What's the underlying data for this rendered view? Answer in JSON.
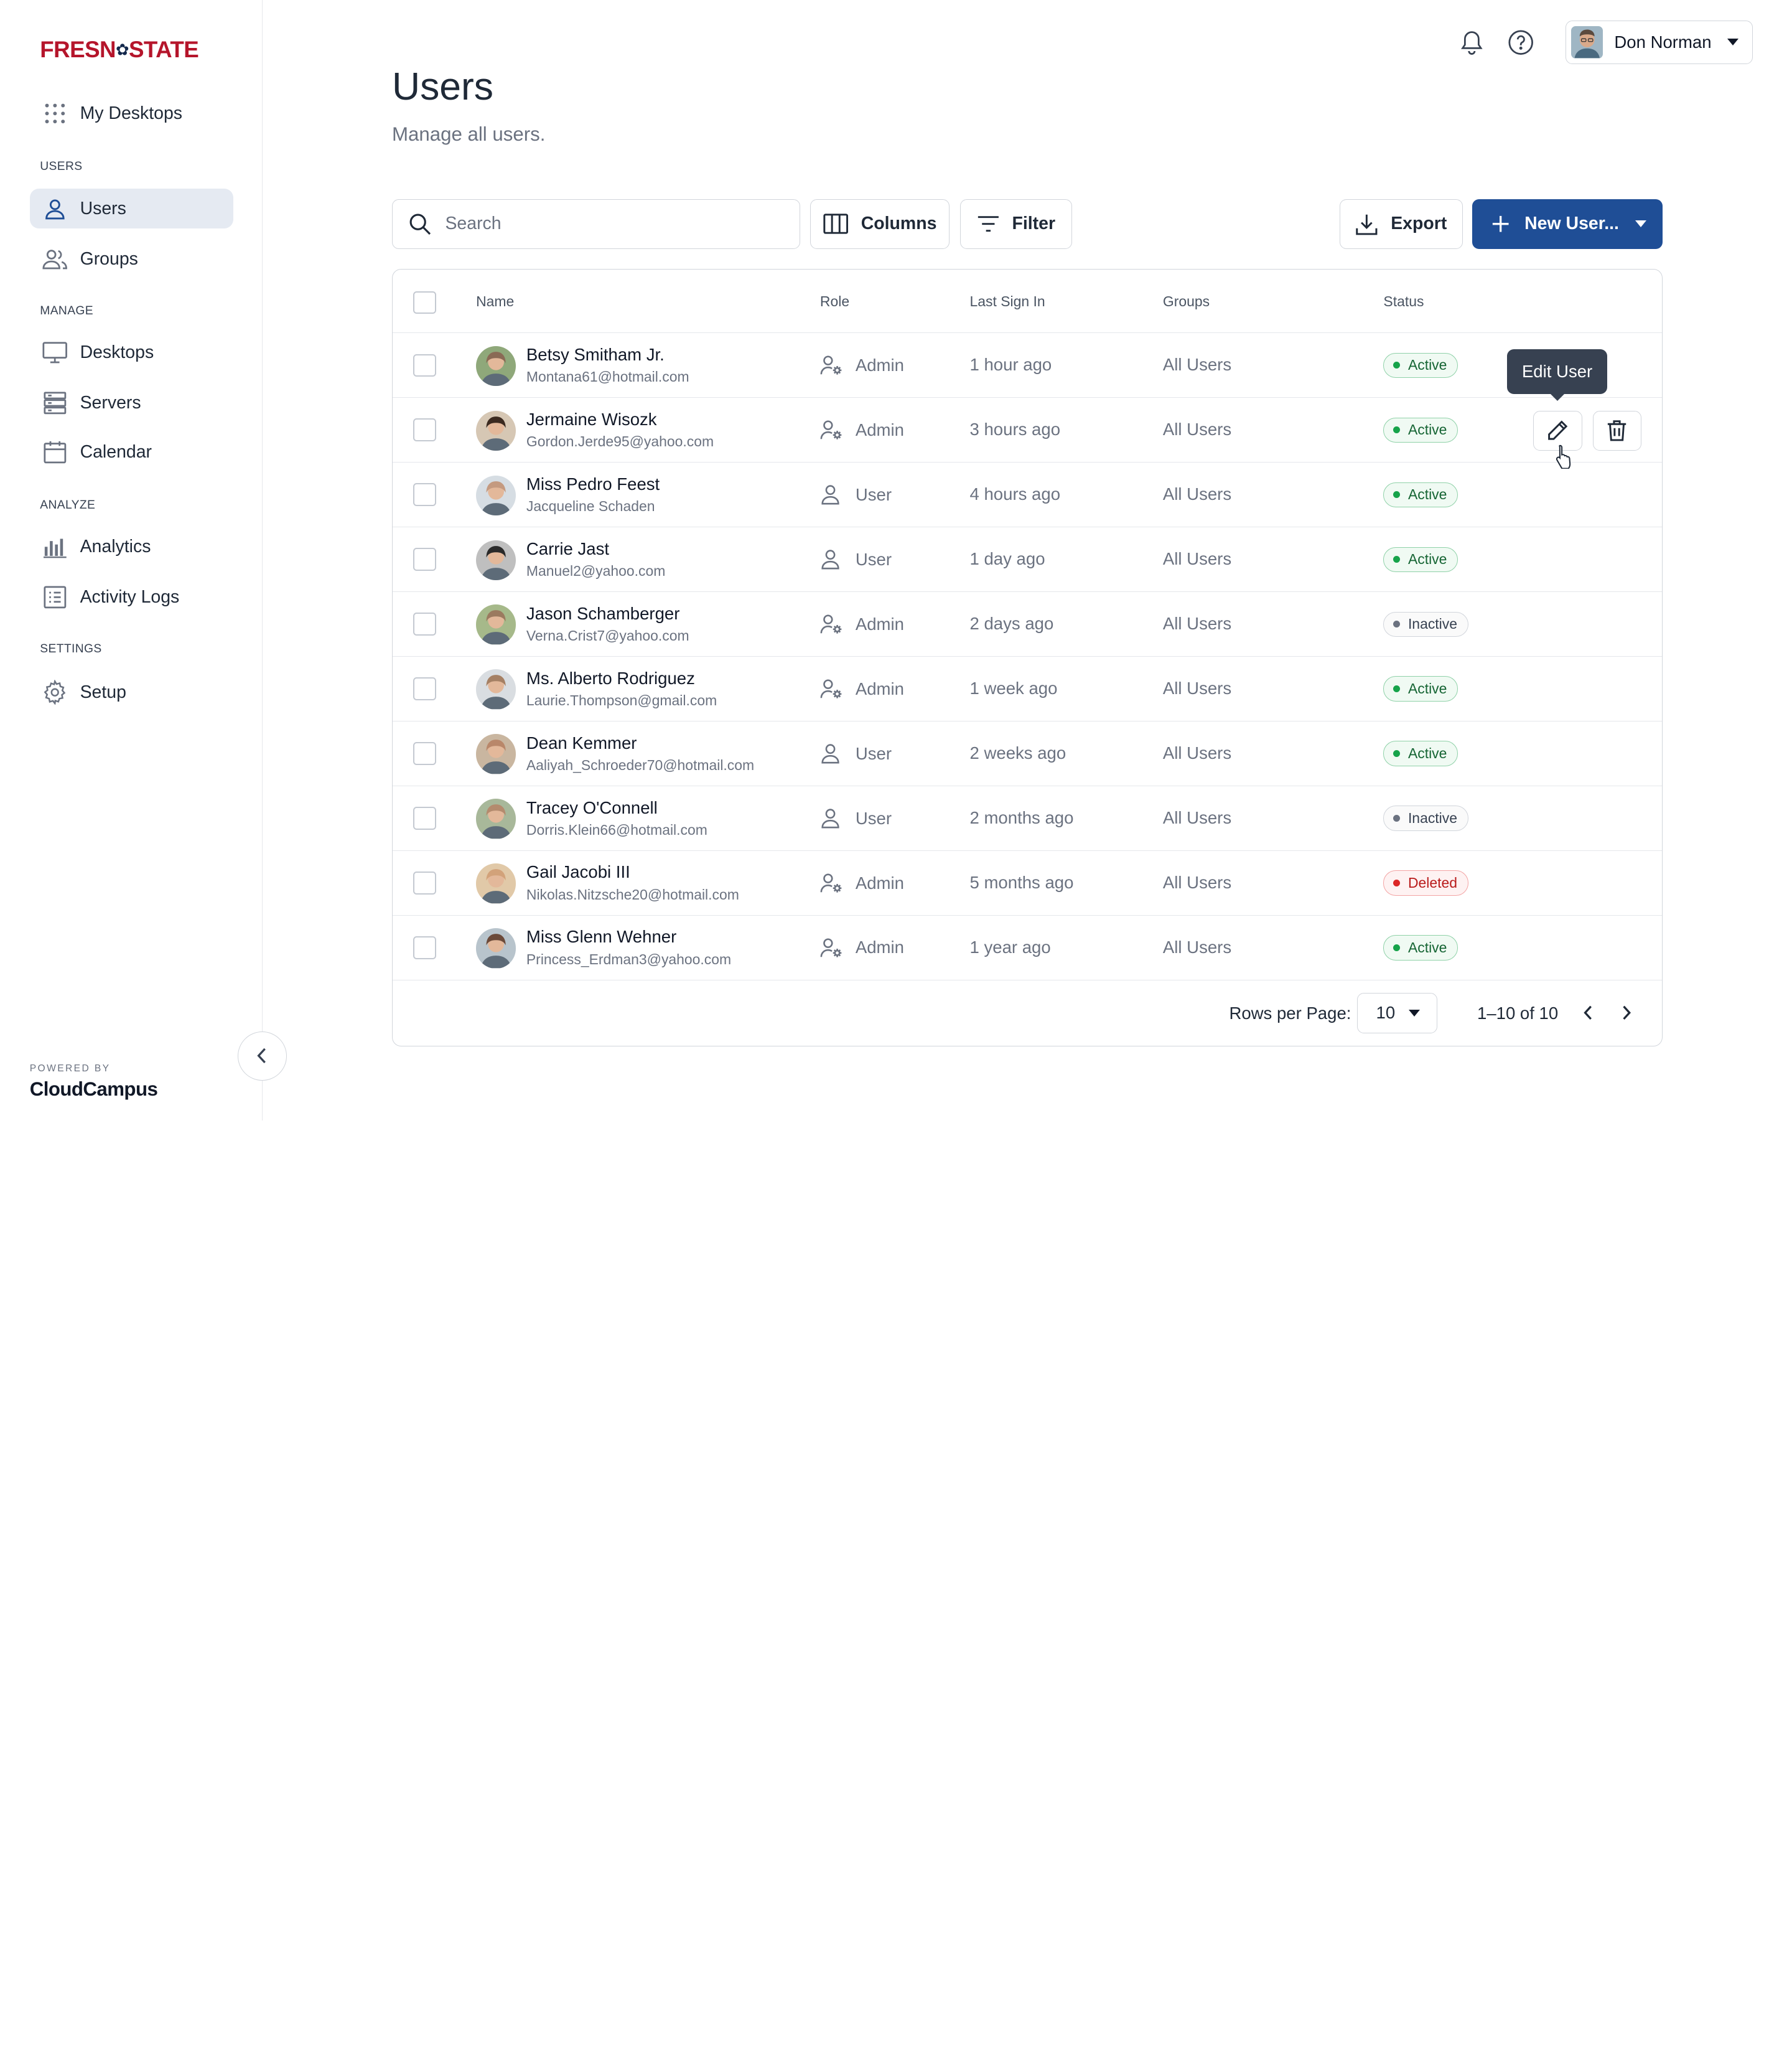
{
  "brand": {
    "logo_left": "FRESN",
    "logo_mark": "✿",
    "logo_right": "STATE",
    "powered_by": "POWERED BY",
    "vendor": "CloudCampus",
    "brand_red": "#b5152b",
    "brand_blue": "#1f4e96"
  },
  "sidebar": {
    "top_item": {
      "label": "My Desktops",
      "icon": "grid-icon"
    },
    "sections": [
      {
        "label": "USERS",
        "items": [
          {
            "label": "Users",
            "icon": "user-icon",
            "active": true
          },
          {
            "label": "Groups",
            "icon": "users-icon",
            "active": false
          }
        ]
      },
      {
        "label": "MANAGE",
        "items": [
          {
            "label": "Desktops",
            "icon": "monitor-icon",
            "active": false
          },
          {
            "label": "Servers",
            "icon": "server-icon",
            "active": false
          },
          {
            "label": "Calendar",
            "icon": "calendar-icon",
            "active": false
          }
        ]
      },
      {
        "label": "ANALYZE",
        "items": [
          {
            "label": "Analytics",
            "icon": "bar-chart-icon",
            "active": false
          },
          {
            "label": "Activity Logs",
            "icon": "list-icon",
            "active": false
          }
        ]
      },
      {
        "label": "SETTINGS",
        "items": [
          {
            "label": "Setup",
            "icon": "gear-icon",
            "active": false
          }
        ]
      }
    ]
  },
  "header": {
    "user_name": "Don Norman",
    "icons": [
      "bell-icon",
      "help-icon"
    ]
  },
  "page": {
    "title": "Users",
    "subtitle": "Manage all users."
  },
  "toolbar": {
    "search_placeholder": "Search",
    "columns_label": "Columns",
    "filter_label": "Filter",
    "export_label": "Export",
    "new_user_label": "New User..."
  },
  "table": {
    "headers": {
      "name": "Name",
      "role": "Role",
      "last_sign_in": "Last Sign In",
      "groups": "Groups",
      "status": "Status"
    },
    "rows": [
      {
        "name": "Betsy Smitham Jr.",
        "email": "Montana61@hotmail.com",
        "role": "Admin",
        "last_sign_in": "1 hour ago",
        "groups": "All Users",
        "status": "Active"
      },
      {
        "name": "Jermaine Wisozk",
        "email": "Gordon.Jerde95@yahoo.com",
        "role": "Admin",
        "last_sign_in": "3 hours ago",
        "groups": "All Users",
        "status": "Active"
      },
      {
        "name": "Miss Pedro Feest",
        "email": "Jacqueline Schaden",
        "role": "User",
        "last_sign_in": "4 hours ago",
        "groups": "All Users",
        "status": "Active"
      },
      {
        "name": "Carrie Jast",
        "email": "Manuel2@yahoo.com",
        "role": "User",
        "last_sign_in": "1 day ago",
        "groups": "All Users",
        "status": "Active"
      },
      {
        "name": "Jason Schamberger",
        "email": "Verna.Crist7@yahoo.com",
        "role": "Admin",
        "last_sign_in": "2 days ago",
        "groups": "All Users",
        "status": "Inactive"
      },
      {
        "name": "Ms. Alberto Rodriguez",
        "email": "Laurie.Thompson@gmail.com",
        "role": "Admin",
        "last_sign_in": "1 week ago",
        "groups": "All Users",
        "status": "Active"
      },
      {
        "name": "Dean Kemmer",
        "email": "Aaliyah_Schroeder70@hotmail.com",
        "role": "User",
        "last_sign_in": "2 weeks ago",
        "groups": "All Users",
        "status": "Active"
      },
      {
        "name": "Tracey O'Connell",
        "email": "Dorris.Klein66@hotmail.com",
        "role": "User",
        "last_sign_in": "2 months ago",
        "groups": "All Users",
        "status": "Inactive"
      },
      {
        "name": "Gail Jacobi III",
        "email": "Nikolas.Nitzsche20@hotmail.com",
        "role": "Admin",
        "last_sign_in": "5 months ago",
        "groups": "All Users",
        "status": "Deleted"
      },
      {
        "name": "Miss Glenn Wehner",
        "email": "Princess_Erdman3@yahoo.com",
        "role": "Admin",
        "last_sign_in": "1 year ago",
        "groups": "All Users",
        "status": "Active"
      }
    ],
    "hovered_row": 1,
    "tooltip": "Edit User",
    "row_actions": [
      "edit-icon",
      "trash-icon"
    ]
  },
  "pagination": {
    "rows_per_page_label": "Rows per Page:",
    "rows_per_page": "10",
    "range": "1–10 of 10"
  }
}
